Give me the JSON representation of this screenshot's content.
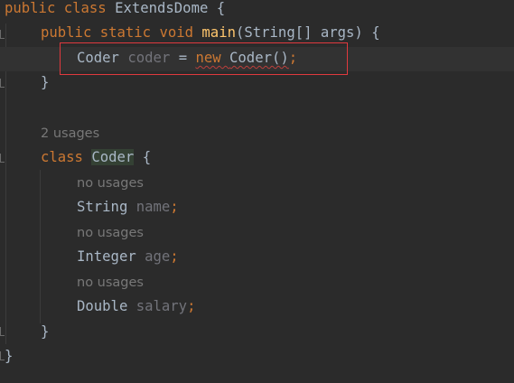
{
  "code": {
    "l1": {
      "kw1": "public",
      "kw2": "class",
      "name": "ExtendsDome",
      "brace": "{"
    },
    "l2": {
      "kw1": "public",
      "kw2": "static",
      "kw3": "void",
      "fn": "main",
      "params": "(String[] args)",
      "brace": "{"
    },
    "l3": {
      "type": "Coder",
      "var": "coder",
      "eq": "=",
      "kw": "new",
      "ctor": "Coder()",
      "semi": ";"
    },
    "l4": {
      "brace": "}"
    },
    "usages_class": "2 usages",
    "l6": {
      "kw": "class",
      "name": "Coder",
      "brace": "{"
    },
    "usage_name": "no usages",
    "l8": {
      "type": "String",
      "field": "name",
      "semi": ";"
    },
    "usage_age": "no usages",
    "l10": {
      "type": "Integer",
      "field": "age",
      "semi": ";"
    },
    "usage_salary": "no usages",
    "l12": {
      "type": "Double",
      "field": "salary",
      "semi": ";"
    },
    "l13": {
      "brace": "}"
    },
    "l14": {
      "brace": "}"
    }
  },
  "colors": {
    "background": "#2b2b2b",
    "keyword": "#cc7832",
    "function": "#ffc66d",
    "text": "#a9b7c6",
    "inlay_hint": "#787878",
    "annotation_box": "#e0393e"
  }
}
